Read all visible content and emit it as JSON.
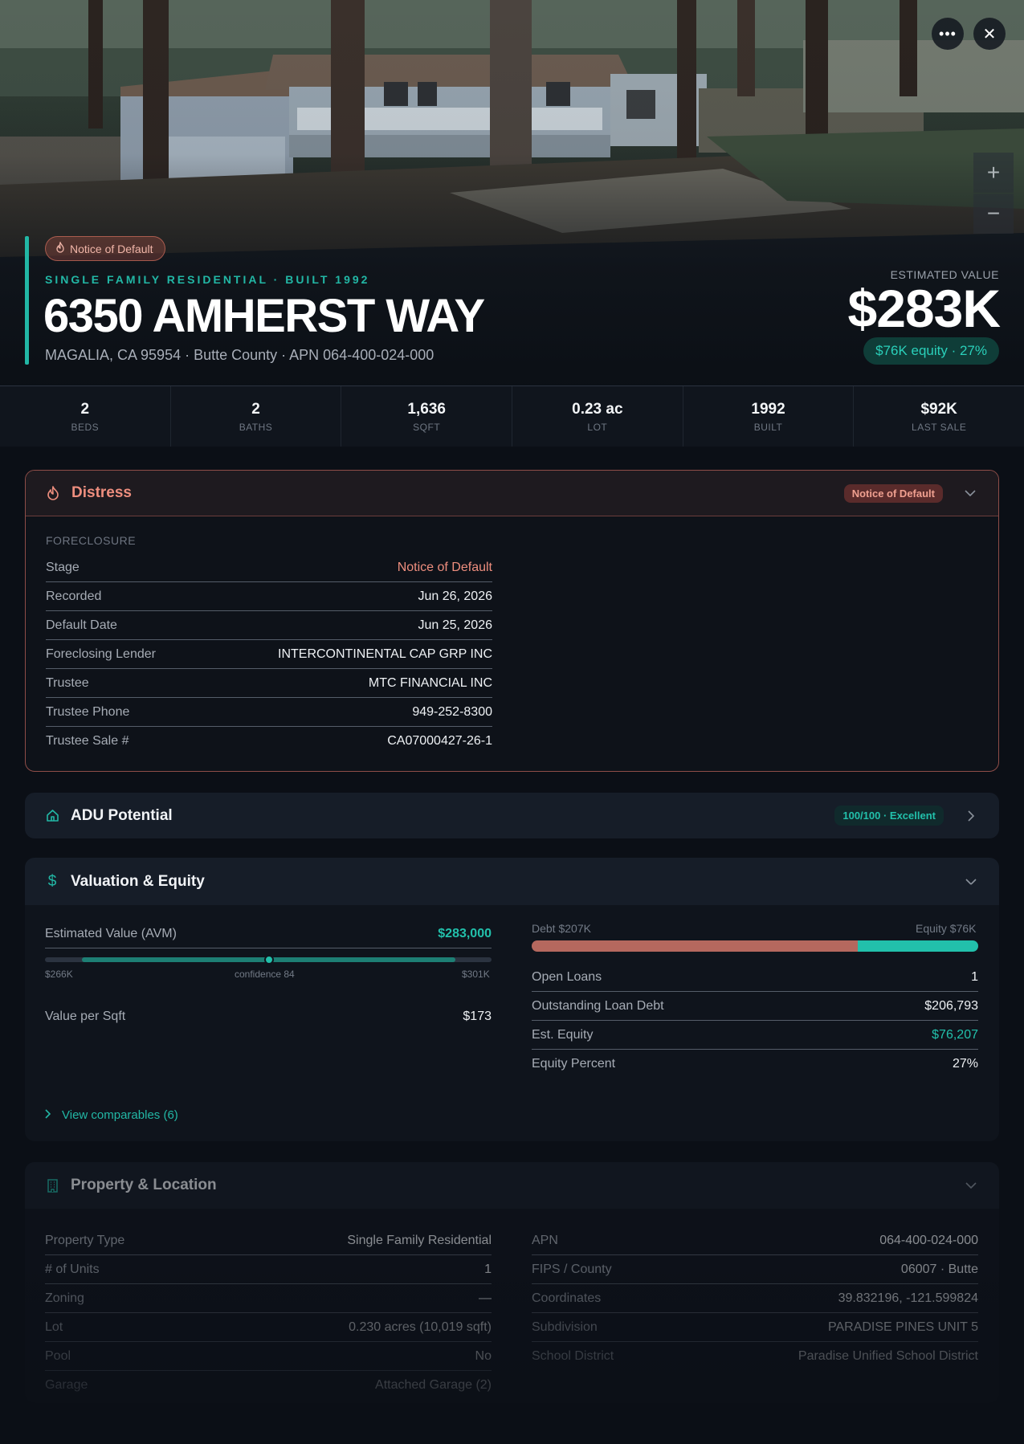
{
  "hero": {
    "status_badge": "Notice of Default",
    "subtype": "SINGLE FAMILY RESIDENTIAL · BUILT 1992",
    "address": "6350 AMHERST WAY",
    "address_sub": "MAGALIA, CA 95954 · Butte County · APN 064-400-024-000",
    "est_label": "ESTIMATED VALUE",
    "est_value": "$283K",
    "equity_pill": "$76K equity · 27%",
    "more_icon": "more-horizontal-icon",
    "close_icon": "close-icon",
    "zoom_in": "+",
    "zoom_out": "−"
  },
  "stats": [
    {
      "value": "2",
      "label": "BEDS"
    },
    {
      "value": "2",
      "label": "BATHS"
    },
    {
      "value": "1,636",
      "label": "SQFT"
    },
    {
      "value": "0.23 ac",
      "label": "LOT"
    },
    {
      "value": "1992",
      "label": "BUILT"
    },
    {
      "value": "$92K",
      "label": "LAST SALE"
    }
  ],
  "distress": {
    "title": "Distress",
    "badge": "Notice of Default",
    "section": "FORECLOSURE",
    "rows": [
      {
        "k": "Stage",
        "v": "Notice of Default"
      },
      {
        "k": "Recorded",
        "v": "Jun 26, 2026"
      },
      {
        "k": "Default Date",
        "v": "Jun 25, 2026"
      },
      {
        "k": "Foreclosing Lender",
        "v": "INTERCONTINENTAL CAP GRP INC"
      },
      {
        "k": "Trustee",
        "v": "MTC FINANCIAL INC"
      },
      {
        "k": "Trustee Phone",
        "v": "949-252-8300"
      },
      {
        "k": "Trustee Sale #",
        "v": "CA07000427-26-1"
      }
    ]
  },
  "adu": {
    "title": "ADU Potential",
    "badge": "100/100 · Excellent"
  },
  "valuation": {
    "title": "Valuation & Equity",
    "avm_label": "Estimated Value (AVM)",
    "avm_value": "$283,000",
    "range_low": "$266K",
    "range_high": "$301K",
    "confidence": "confidence 84",
    "value_position_pct": 50,
    "vps_label": "Value per Sqft",
    "vps_value": "$173",
    "debt_label": "Debt $207K",
    "equity_label": "Equity $76K",
    "debt_fraction": 0.73,
    "rows": [
      {
        "k": "Open Loans",
        "v": "1"
      },
      {
        "k": "Outstanding Loan Debt",
        "v": "$206,793"
      },
      {
        "k": "Est. Equity",
        "v": "$76,207"
      },
      {
        "k": "Equity Percent",
        "v": "27%"
      }
    ],
    "comps_link": "View comparables (6)"
  },
  "property": {
    "title": "Property & Location",
    "left": [
      {
        "k": "Property Type",
        "v": "Single Family Residential"
      },
      {
        "k": "# of Units",
        "v": "1"
      },
      {
        "k": "Zoning",
        "v": "—"
      },
      {
        "k": "Lot",
        "v": "0.230 acres (10,019 sqft)"
      },
      {
        "k": "Pool",
        "v": "No"
      },
      {
        "k": "Garage",
        "v": "Attached Garage (2)"
      }
    ],
    "right": [
      {
        "k": "APN",
        "v": "064-400-024-000"
      },
      {
        "k": "FIPS / County",
        "v": "06007 · Butte"
      },
      {
        "k": "Coordinates",
        "v": "39.832196, -121.599824"
      },
      {
        "k": "Subdivision",
        "v": "PARADISE PINES UNIT 5"
      },
      {
        "k": "School District",
        "v": "Paradise Unified School District"
      }
    ]
  },
  "colors": {
    "accent": "#22b7a5",
    "distress": "#ee8e7e",
    "debt": "#b5685e",
    "equity": "#22c0ab"
  }
}
